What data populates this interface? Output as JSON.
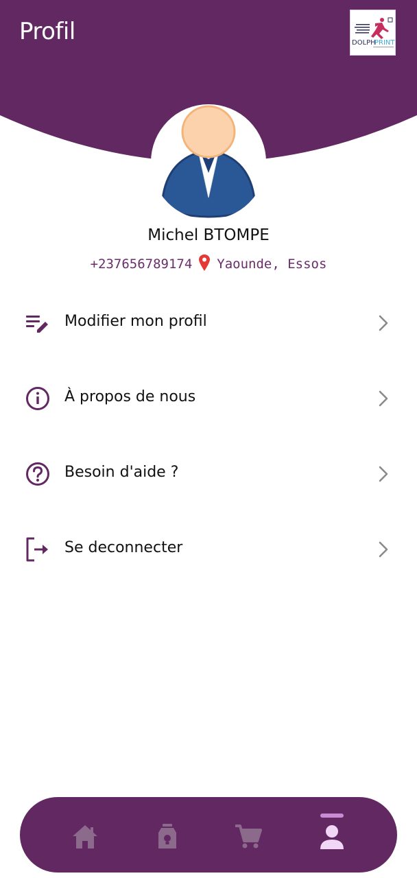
{
  "header": {
    "title": "Profil",
    "logo": {
      "text_top": "DOLPH",
      "text_accent": "PRINT",
      "icon": "runner-logo"
    }
  },
  "profile": {
    "avatar_icon": "user-avatar-icon",
    "name": "Michel BTOMPE",
    "phone": "+237656789174",
    "location": "Yaounde, Essos",
    "pin_icon": "map-pin-icon"
  },
  "menu": [
    {
      "label": "Modifier mon profil",
      "icon": "edit-list-icon"
    },
    {
      "label": "À propos de nous",
      "icon": "info-icon"
    },
    {
      "label": "Besoin d'aide ?",
      "icon": "help-icon"
    },
    {
      "label": "Se deconnecter",
      "icon": "logout-icon"
    }
  ],
  "bottom_nav": {
    "items": [
      {
        "name": "home",
        "icon": "home-icon",
        "active": false
      },
      {
        "name": "orders",
        "icon": "bottle-icon",
        "active": false
      },
      {
        "name": "cart",
        "icon": "cart-icon",
        "active": false
      },
      {
        "name": "profile",
        "icon": "user-icon",
        "active": true
      }
    ]
  },
  "colors": {
    "primary": "#622862",
    "accent": "#6a2e6a",
    "nav_inactive": "#8b6a8b",
    "nav_active": "#f1d6f6",
    "chevron": "#8a8a8a"
  }
}
